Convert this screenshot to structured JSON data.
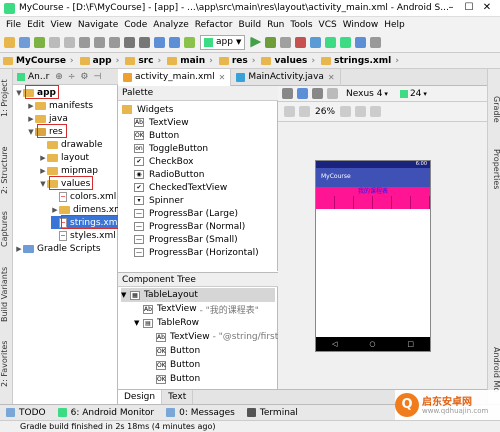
{
  "window": {
    "title": "MyCourse - [D:\\F\\MyCourse] - [app] - ...\\app\\src\\main\\res\\layout\\activity_main.xml - Android S..."
  },
  "menu": [
    "File",
    "Edit",
    "View",
    "Navigate",
    "Code",
    "Analyze",
    "Refactor",
    "Build",
    "Run",
    "Tools",
    "VCS",
    "Window",
    "Help"
  ],
  "toolbar": {
    "run_config": "app"
  },
  "breadcrumbs": [
    "MyCourse",
    "app",
    "src",
    "main",
    "res",
    "values",
    "strings.xml"
  ],
  "project_panel": {
    "selector": "An..r"
  },
  "project_tree": [
    {
      "label": "app",
      "indent": 0,
      "toggle": "▼",
      "icon": "folder",
      "bold": true
    },
    {
      "label": "manifests",
      "indent": 1,
      "toggle": "▶",
      "icon": "folder"
    },
    {
      "label": "java",
      "indent": 1,
      "toggle": "▶",
      "icon": "folder"
    },
    {
      "label": "res",
      "indent": 1,
      "toggle": "▼",
      "icon": "res"
    },
    {
      "label": "drawable",
      "indent": 2,
      "toggle": "",
      "icon": "folder"
    },
    {
      "label": "layout",
      "indent": 2,
      "toggle": "▶",
      "icon": "folder"
    },
    {
      "label": "mipmap",
      "indent": 2,
      "toggle": "▶",
      "icon": "folder"
    },
    {
      "label": "values",
      "indent": 2,
      "toggle": "▼",
      "icon": "folder"
    },
    {
      "label": "colors.xml",
      "indent": 3,
      "toggle": "",
      "icon": "file"
    },
    {
      "label": "dimens.xml",
      "indent": 3,
      "toggle": "▶",
      "icon": "folder"
    },
    {
      "label": "strings.xml",
      "indent": 3,
      "toggle": "",
      "icon": "file",
      "selected": true
    },
    {
      "label": "styles.xml",
      "indent": 3,
      "toggle": "",
      "icon": "file"
    },
    {
      "label": "Gradle Scripts",
      "indent": 0,
      "toggle": "▶",
      "icon": "gradle"
    }
  ],
  "editor_tabs": [
    {
      "label": "activity_main.xml",
      "active": true,
      "color": "#f0a030"
    },
    {
      "label": "MainActivity.java",
      "active": false,
      "color": "#3aa0d8"
    }
  ],
  "palette": {
    "title": "Palette",
    "items": [
      {
        "label": "Widgets",
        "icon": "folder"
      },
      {
        "label": "TextView",
        "icon": "Ab"
      },
      {
        "label": "Button",
        "icon": "OK"
      },
      {
        "label": "ToggleButton",
        "icon": "on"
      },
      {
        "label": "CheckBox",
        "icon": "✔"
      },
      {
        "label": "RadioButton",
        "icon": "◉"
      },
      {
        "label": "CheckedTextView",
        "icon": "✔"
      },
      {
        "label": "Spinner",
        "icon": "▾"
      },
      {
        "label": "ProgressBar (Large)",
        "icon": "—"
      },
      {
        "label": "ProgressBar (Normal)",
        "icon": "—"
      },
      {
        "label": "ProgressBar (Small)",
        "icon": "—"
      },
      {
        "label": "ProgressBar (Horizontal)",
        "icon": "—"
      }
    ]
  },
  "component_tree": {
    "title": "Component Tree",
    "items": [
      {
        "label": "TableLayout",
        "detail": "",
        "indent": 0,
        "toggle": "▼",
        "icon": "▦",
        "selected": true
      },
      {
        "label": "TextView",
        "detail": "- \"我的课程表\"",
        "indent": 1,
        "toggle": "",
        "icon": "Ab"
      },
      {
        "label": "TableRow",
        "detail": "",
        "indent": 1,
        "toggle": "▼",
        "icon": "▤"
      },
      {
        "label": "TextView",
        "detail": "- \"@string/first\"",
        "indent": 2,
        "toggle": "",
        "icon": "Ab"
      },
      {
        "label": "Button",
        "detail": "",
        "indent": 2,
        "toggle": "",
        "icon": "OK"
      },
      {
        "label": "Button",
        "detail": "",
        "indent": 2,
        "toggle": "",
        "icon": "OK"
      },
      {
        "label": "Button",
        "detail": "",
        "indent": 2,
        "toggle": "",
        "icon": "OK"
      }
    ]
  },
  "preview_toolbar": {
    "device": "Nexus 4",
    "api": "24",
    "zoom": "26%"
  },
  "phone": {
    "clock": "6:00",
    "app_title": "MyCourse",
    "table_title": "我的课程表"
  },
  "design_tabs": [
    "Design",
    "Text"
  ],
  "side_tabs_left": [
    "1: Project",
    "2: Structure",
    "Captures",
    "Build Variants",
    "2: Favorites"
  ],
  "side_tabs_right": [
    "Gradle",
    "Properties",
    "Android Mo"
  ],
  "bottom_tabs": [
    {
      "label": "TODO",
      "color": "#7aa6d8"
    },
    {
      "label": "6: Android Monitor",
      "color": "#3ddc84"
    },
    {
      "label": "0: Messages",
      "color": "#7aa6d8"
    },
    {
      "label": "Terminal",
      "color": "#555555"
    }
  ],
  "status": "Gradle build finished in 2s 18ms (4 minutes ago)",
  "watermark": {
    "logo": "Q",
    "name": "启东安卓网",
    "url": "www.qdhuajin.com"
  }
}
